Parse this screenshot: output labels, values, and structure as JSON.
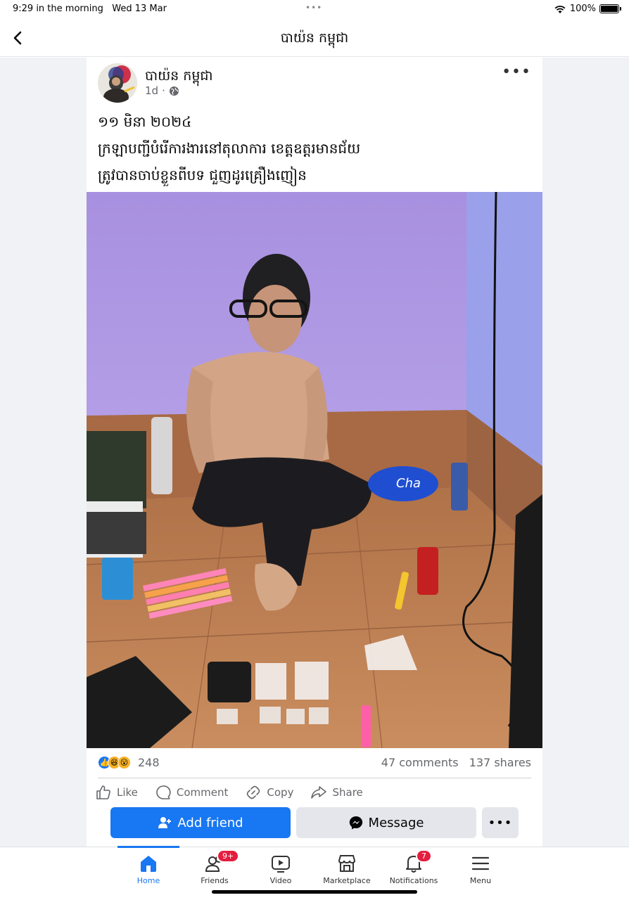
{
  "status_bar": {
    "time": "9:29 in the morning",
    "date": "Wed 13 Mar",
    "dots": "•••",
    "battery": "100%",
    "battery_level": 1.0
  },
  "header": {
    "title": "បាយ៉ន កម្ពុជា"
  },
  "post": {
    "author": "បាយ៉ន កម្ពុជា",
    "time": "1d",
    "separator": "·",
    "more": "•••",
    "text_lines": [
      "១១ មិនា ២០២៤",
      "ក្រឡាបញ្ជីបំរើការងារនៅតុលាការ ខេត្តឧត្តរមានជ័យ",
      "ត្រូវបានចាប់ខ្លួនពីបទ ជួញដូរគ្រឿងញៀន"
    ],
    "reactions_count": "248",
    "comments": "47 comments",
    "shares": "137 shares"
  },
  "actions": {
    "like": "Like",
    "comment": "Comment",
    "copy": "Copy",
    "share": "Share"
  },
  "cta": {
    "add_friend": "Add friend",
    "message": "Message",
    "more": "•••"
  },
  "bottom_nav": {
    "home": "Home",
    "friends": "Friends",
    "friends_badge": "9+",
    "video": "Video",
    "marketplace": "Marketplace",
    "notifications": "Notifications",
    "notifications_badge": "7",
    "menu": "Menu"
  },
  "colors": {
    "accent": "#1877f2",
    "badge": "#e41e3f",
    "feed_background": "#f0f2f5"
  }
}
